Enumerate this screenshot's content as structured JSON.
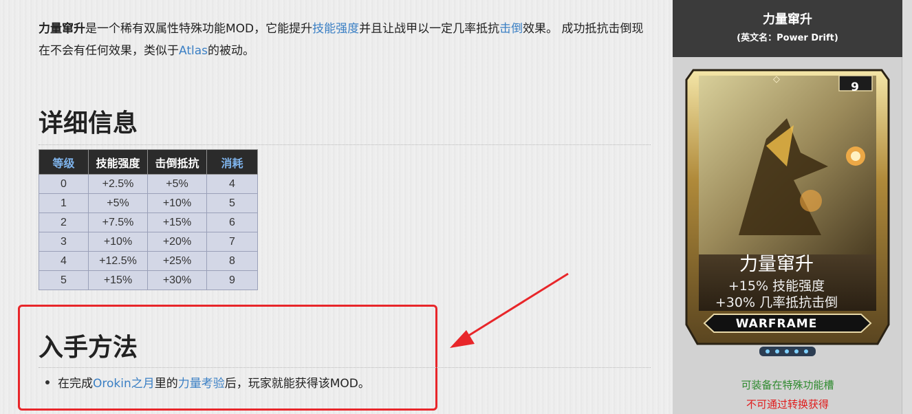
{
  "intro": {
    "bold_name": "力量窜升",
    "t1": "是一个稀有双属性特殊功能MOD，它能提升",
    "link1": "技能强度",
    "t2": "并且让战甲以一定几率抵抗",
    "link2": "击倒",
    "t3": "效果。 成功抵抗击倒现在不会有任何效果，类似于",
    "link3": "Atlas",
    "t4": "的被动。"
  },
  "details": {
    "heading": "详细信息",
    "table": {
      "headers": [
        "等级",
        "技能强度",
        "击倒抵抗",
        "消耗"
      ],
      "rows": [
        [
          "0",
          "+2.5%",
          "+5%",
          "4"
        ],
        [
          "1",
          "+5%",
          "+10%",
          "5"
        ],
        [
          "2",
          "+7.5%",
          "+15%",
          "6"
        ],
        [
          "3",
          "+10%",
          "+20%",
          "7"
        ],
        [
          "4",
          "+12.5%",
          "+25%",
          "8"
        ],
        [
          "5",
          "+15%",
          "+30%",
          "9"
        ]
      ]
    }
  },
  "acquisition": {
    "heading": "入手方法",
    "t1": "在完成",
    "link1": "Orokin之月",
    "t2": "里的",
    "link2": "力量考验",
    "t3": "后，玩家就能获得该MOD。"
  },
  "sidebar": {
    "title": "力量窜升",
    "subtitle": "(英文名：Power Drift)",
    "card": {
      "name": "力量窜升",
      "stat1": "+15% 技能强度",
      "stat2": "+30% 几率抵抗击倒",
      "banner": "WARFRAME",
      "rank": "9",
      "polarity_icon": "naramon-polarity-icon"
    },
    "note_green": "可装备在特殊功能槽",
    "note_red": "不可通过转换获得"
  },
  "colors": {
    "link": "#3a7fc4",
    "highlight_box": "#e8262a",
    "note_green": "#2f8a2f",
    "note_red": "#e01c1c"
  }
}
